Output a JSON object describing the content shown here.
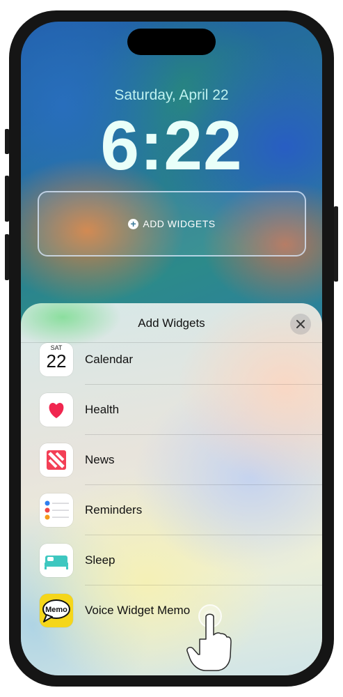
{
  "lock_screen": {
    "date": "Saturday, April 22",
    "time": "6:22",
    "add_widgets_label": "ADD WIDGETS"
  },
  "sheet": {
    "title": "Add Widgets",
    "close_icon": "close-icon",
    "items": [
      {
        "label": "Calendar",
        "icon": "calendar-icon",
        "day": "SAT",
        "date_num": "22"
      },
      {
        "label": "Health",
        "icon": "heart-icon"
      },
      {
        "label": "News",
        "icon": "news-icon"
      },
      {
        "label": "Reminders",
        "icon": "reminders-icon"
      },
      {
        "label": "Sleep",
        "icon": "bed-icon"
      },
      {
        "label": "Voice Widget Memo",
        "icon": "memo-icon",
        "icon_text": "Memo"
      }
    ]
  },
  "colors": {
    "health": "#f0264f",
    "news": "#f33f56",
    "sleep": "#3ec7c0",
    "memo": "#f5d61a"
  }
}
